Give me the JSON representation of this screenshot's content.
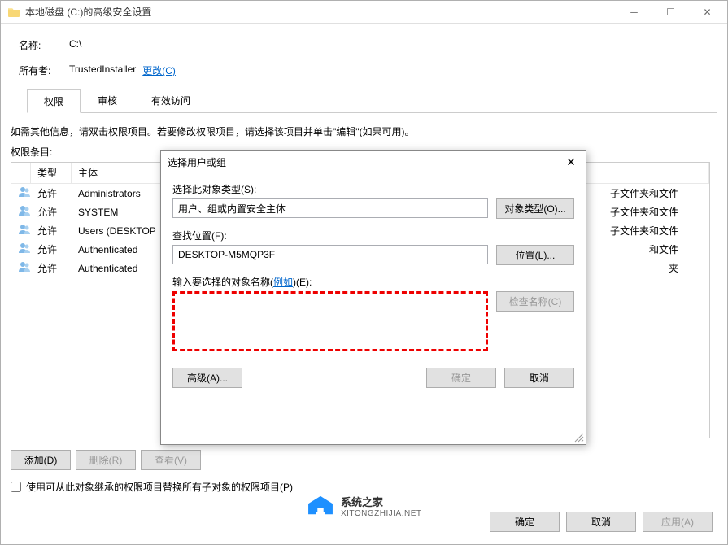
{
  "main_window": {
    "title": "本地磁盘 (C:)的高级安全设置",
    "name_label": "名称:",
    "name_value": "C:\\",
    "owner_label": "所有者:",
    "owner_value": "TrustedInstaller",
    "change_link": "更改(C)",
    "tabs": {
      "permissions": "权限",
      "audit": "审核",
      "effective": "有效访问"
    },
    "description": "如需其他信息，请双击权限项目。若要修改权限项目，请选择该项目并单击\"编辑\"(如果可用)。",
    "entries_label": "权限条目:",
    "columns": {
      "type": "类型",
      "principal": "主体"
    },
    "rows": [
      {
        "type": "允许",
        "principal": "Administrators",
        "apply": "子文件夹和文件"
      },
      {
        "type": "允许",
        "principal": "SYSTEM",
        "apply": "子文件夹和文件"
      },
      {
        "type": "允许",
        "principal": "Users (DESKTOP",
        "apply": "子文件夹和文件"
      },
      {
        "type": "允许",
        "principal": "Authenticated",
        "apply": "和文件"
      },
      {
        "type": "允许",
        "principal": "Authenticated",
        "apply": "夹"
      }
    ],
    "buttons": {
      "add": "添加(D)",
      "remove": "删除(R)",
      "view": "查看(V)"
    },
    "checkbox_text": "使用可从此对象继承的权限项目替换所有子对象的权限项目(P)",
    "dialog_buttons": {
      "ok": "确定",
      "cancel": "取消",
      "apply": "应用(A)"
    }
  },
  "modal": {
    "title": "选择用户或组",
    "object_type_label": "选择此对象类型(S):",
    "object_type_value": "用户、组或内置安全主体",
    "object_type_btn": "对象类型(O)...",
    "location_label": "查找位置(F):",
    "location_value": "DESKTOP-M5MQP3F",
    "location_btn": "位置(L)...",
    "name_label_prefix": "输入要选择的对象名称(",
    "name_label_example": "例如",
    "name_label_suffix": ")(E):",
    "check_btn": "检查名称(C)",
    "advanced_btn": "高级(A)...",
    "ok_btn": "确定",
    "cancel_btn": "取消"
  },
  "watermark": {
    "line1": "系统之家",
    "line2": "XITONGZHIJIA.NET"
  }
}
